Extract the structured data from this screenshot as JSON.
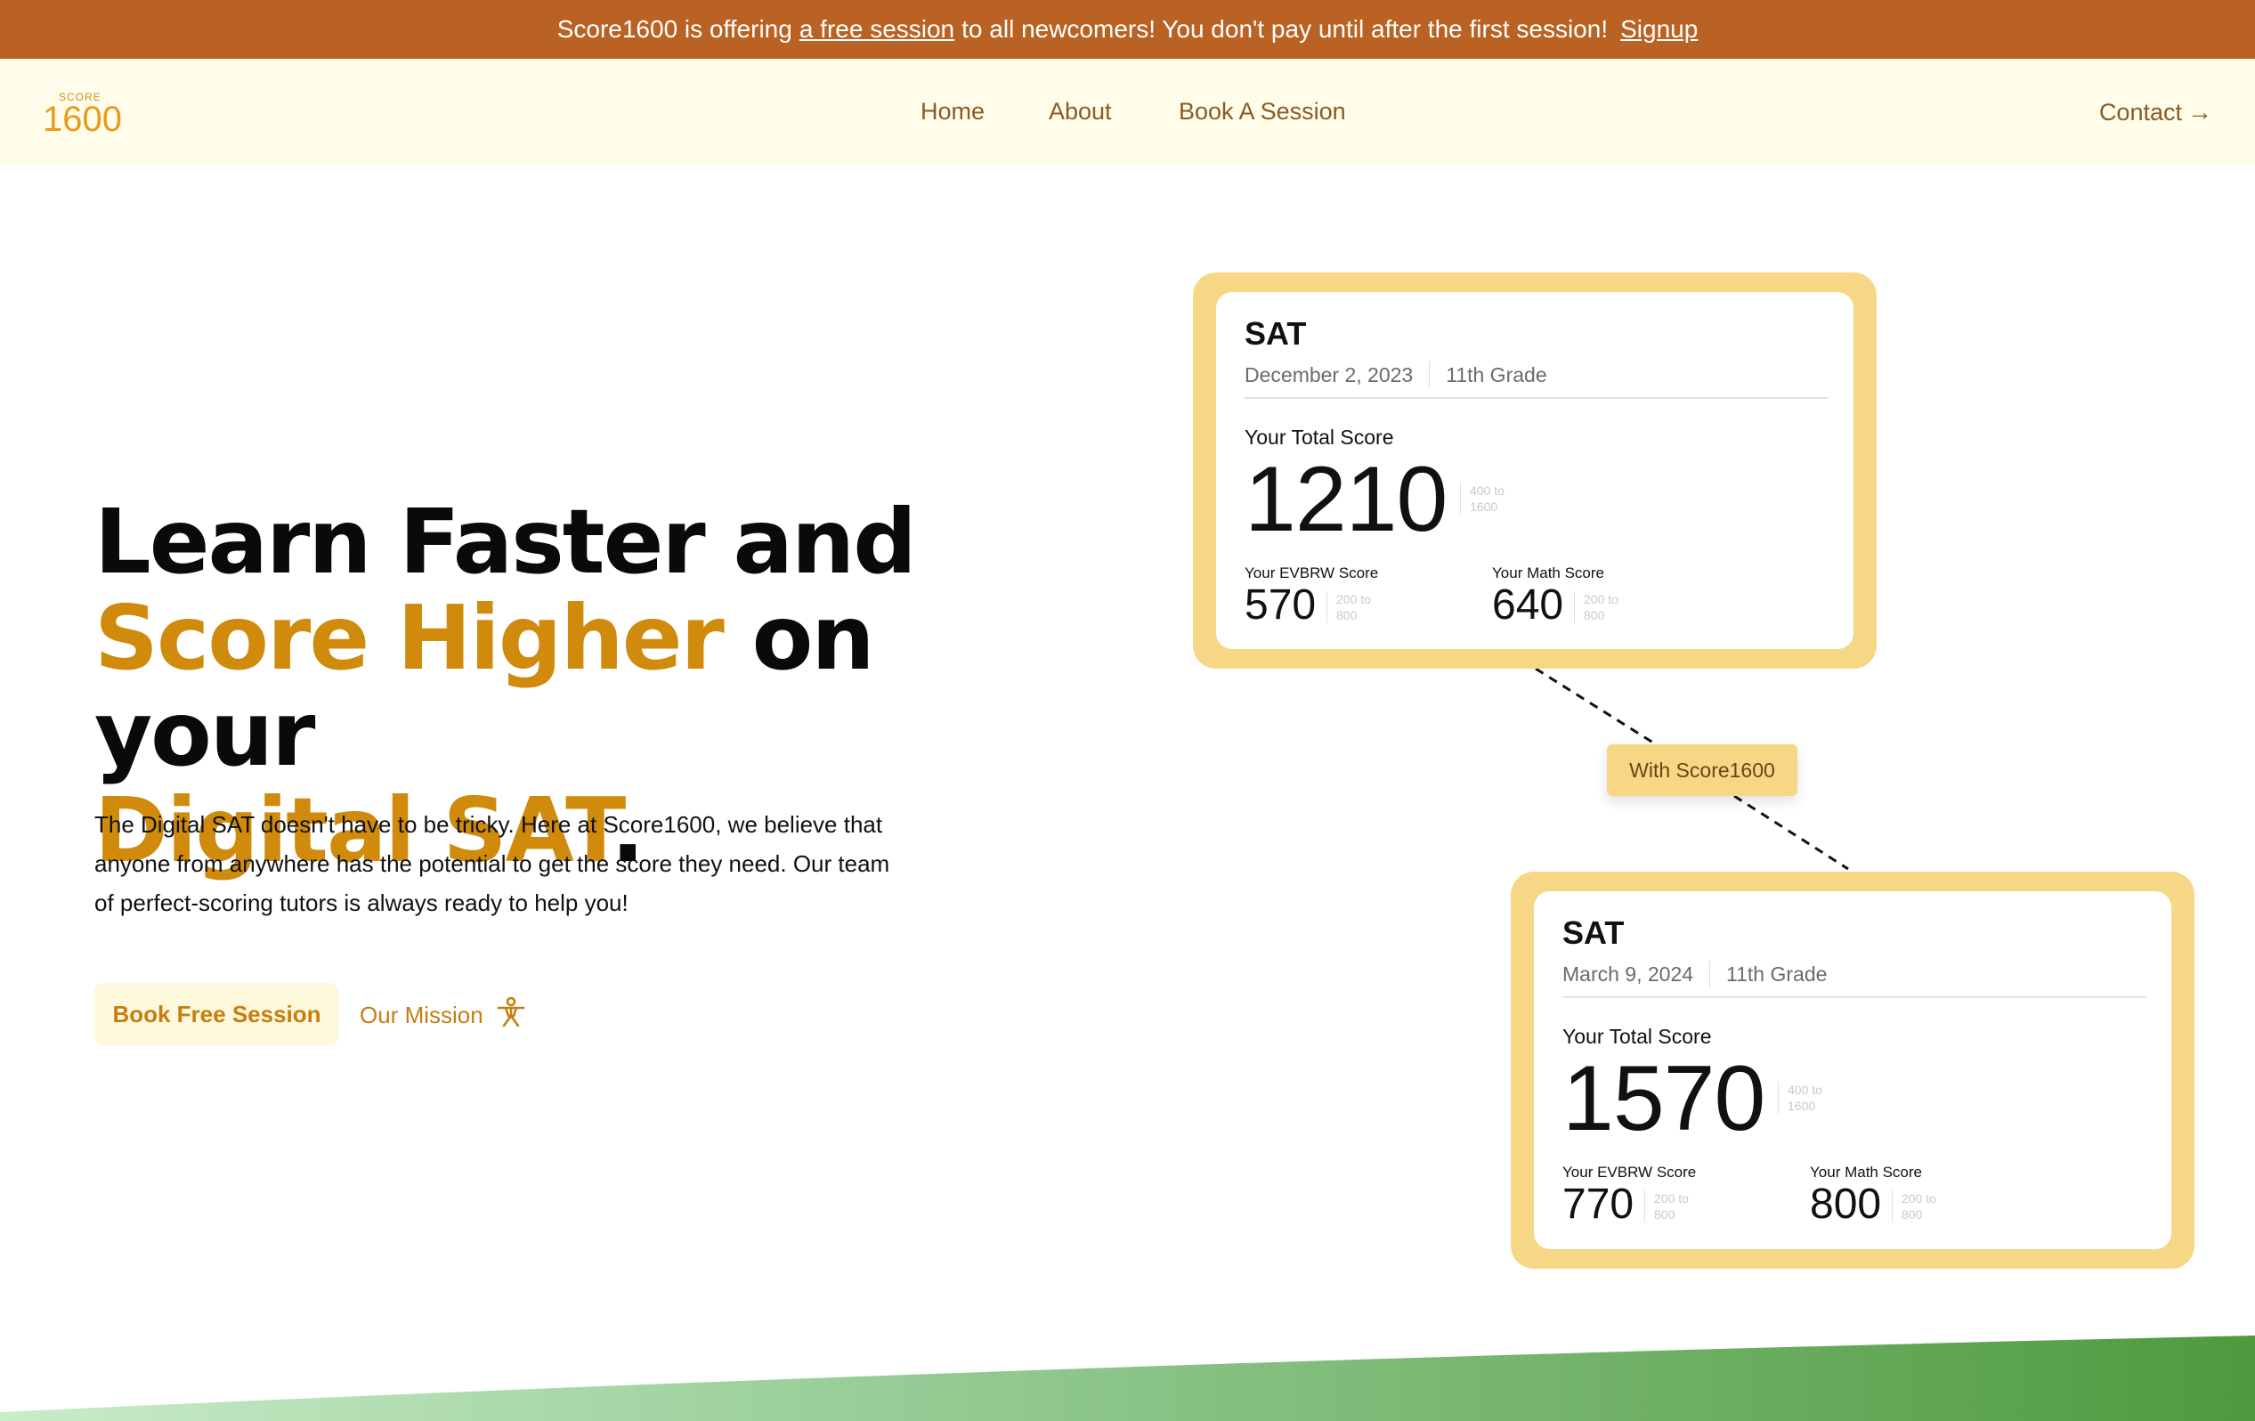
{
  "announcement": {
    "prefix": "Score1600 is offering",
    "link_text": "a free session",
    "suffix": "to all newcomers! You don't pay until after the first session!",
    "signup_label": "Signup"
  },
  "header": {
    "logo_small": "SCORE",
    "logo_big": "1600",
    "nav": [
      "Home",
      "About",
      "Book A Session"
    ],
    "contact_label": "Contact",
    "contact_arrow": "→"
  },
  "hero": {
    "line1": "Learn Faster and",
    "line2_gold": "Score Higher",
    "line2_rest": " on your",
    "line3_gold": "Digital SAT",
    "line3_rest": ".",
    "description": "The Digital SAT doesn't have to be tricky. Here at Score1600, we believe that anyone from anywhere has the potential to get the score they need. Our team of perfect-scoring tutors is always ready to help you!",
    "book_button": "Book Free Session",
    "mission_button": "Our Mission"
  },
  "cards": [
    {
      "title": "SAT",
      "date": "December 2, 2023",
      "grade": "11th Grade",
      "total_label": "Your Total Score",
      "total": "1210",
      "total_range": "400 to 1600",
      "evbrw_label": "Your EVBRW Score",
      "evbrw": "570",
      "evbrw_range": "200 to 800",
      "math_label": "Your Math Score",
      "math": "640",
      "math_range": "200 to 800"
    },
    {
      "title": "SAT",
      "date": "March 9, 2024",
      "grade": "11th Grade",
      "total_label": "Your Total Score",
      "total": "1570",
      "total_range": "400 to 1600",
      "evbrw_label": "Your EVBRW Score",
      "evbrw": "770",
      "evbrw_range": "200 to 800",
      "math_label": "Your Math Score",
      "math": "800",
      "math_range": "200 to 800"
    }
  ],
  "badge": "With Score1600",
  "colors": {
    "announce_bg": "#b96223",
    "header_bg": "#fffdea",
    "accent_gold": "#d08a0c",
    "card_border": "#f6d786",
    "wave_green": "#4f9a3f"
  }
}
